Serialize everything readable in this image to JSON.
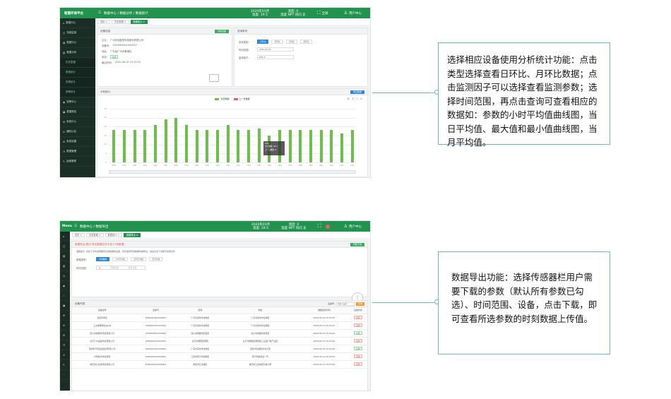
{
  "screenshot1": {
    "app_title": "智慧环保平台",
    "breadcrumb": "数据中心 / 数据分析 / 数据统计",
    "top_item_1": "2020年01月",
    "top_item_2": "温度: 19.5",
    "top_item_3": "湿度: 0",
    "top_item_4": "温度 NPT 风向 东",
    "top_item_5": "全屏",
    "top_user": "用户中心",
    "tabs": [
      "首页 ×",
      "历史数据 ×",
      "数据统计 ×"
    ],
    "sidebar": [
      "数据中心",
      "传感监测",
      "数据中心",
      "数据分析",
      "历史数据",
      "数据统计",
      "告警统计",
      "报警统计",
      "告警中心",
      "数据报告",
      "系统中心",
      "通知公告",
      "系统设置",
      "数据管理",
      "运维管理"
    ],
    "device_panel": {
      "title": "设备信息",
      "button": "切换设备",
      "fields": [
        {
          "label": "企业:",
          "value": "广州凯瑞智慧科技股份有限公司"
        },
        {
          "label": "设备号:",
          "value": "2020062601000007"
        },
        {
          "label": "地址:",
          "value": "广东省广州市黄浦区"
        },
        {
          "label": "状态:",
          "value": "在线"
        },
        {
          "label": "最后时间:",
          "value": "2020-06-19 19:12:00"
        }
      ]
    },
    "condition_panel": {
      "title": "查询条件",
      "type_label": "查询类型:",
      "type_options": [
        "日环比",
        "月环比",
        "日同比",
        "月同比"
      ],
      "time_label": "时间范围:",
      "time_value": "2020-06-19",
      "factor_label": "监测因子:",
      "factor_value": "PM2.5"
    },
    "chart_panel": {
      "title": "分析统计",
      "button": "导出数据",
      "legend": [
        "当日数据",
        "上一日数据"
      ],
      "tooltip_time": "13时",
      "tooltip_line1": "当日数据: 24.5",
      "tooltip_line2": "上一日数据: 0"
    },
    "chart_data": {
      "type": "bar",
      "categories": [
        "00时",
        "01时",
        "02时",
        "03时",
        "04时",
        "05时",
        "06时",
        "07时",
        "08时",
        "09时",
        "10时",
        "11时",
        "12时",
        "13时",
        "14时",
        "15时",
        "16时",
        "17时",
        "18时",
        "19时",
        "20时",
        "21时",
        "22时",
        "23时"
      ],
      "series": [
        {
          "name": "当日数据",
          "values": [
            18,
            18,
            18,
            18,
            21,
            24,
            25,
            21,
            18,
            18,
            18,
            21,
            18,
            18,
            19,
            15,
            18,
            18,
            18,
            18,
            18,
            18,
            16,
            18
          ]
        },
        {
          "name": "上一日数据",
          "values": [
            0,
            0,
            0,
            0,
            0,
            0,
            0,
            0,
            0,
            0,
            0,
            0,
            0,
            0,
            0,
            0,
            0,
            0,
            0,
            0,
            0,
            0,
            0,
            0
          ]
        }
      ],
      "y_ticks": [
        "0",
        "5",
        "10",
        "15",
        "20",
        "25",
        "30"
      ],
      "ylim": [
        0,
        30
      ],
      "colors": {
        "当日数据": "#6cc04a",
        "上一日数据": "#e8635a"
      }
    }
  },
  "screenshot2": {
    "app_title": "Menu",
    "breadcrumb": "数据中心 / 数据导出",
    "tabs": [
      "首页 ×",
      "历史数据 ×",
      "数据统计 ×",
      "数据导出 ×"
    ],
    "export_panel": {
      "title": "数据导出(提示:导出数据文件大至少?份数据)",
      "button": "开始下载",
      "hint": "温馨提示: 当在下方勾选需要导出的数据的设备，则表格所有的数据将被导出，最后点击下载即可获得文件",
      "type_label": "数据类型:",
      "type_options": [
        "时刻数据",
        "小时平均值",
        "日均平均值",
        "月平均值"
      ],
      "time_label": "时间范围:",
      "time_start": "开始日期",
      "time_end": "结束日期"
    },
    "device_list": {
      "title": "设备列表",
      "search_label": "设备号:",
      "search_placeholder": "请输入设备",
      "search_button": "查询",
      "columns": [
        "设备名称",
        "设备号",
        "区域",
        "地址",
        "数据最新时间",
        "设备状态"
      ],
      "rows": [
        {
          "name": "温度风测试",
          "code": "2020061801000007",
          "area": "广东省深圳市龙岗区",
          "addr": "广东省深圳市龙岗区",
          "time": "2020-06-19 15:03:01",
          "status": "离线"
        },
        {
          "name": "工业物联网企业AIR",
          "code": "2020061501000001",
          "area": "广东省深圳市龙岗区",
          "addr": "广东省深圳市龙岗区",
          "time": "2020-06-19 15:03:01",
          "status": "离线"
        },
        {
          "name": "四川省成都市测试有限公司",
          "code": "2020060501000004",
          "area": "四川省成都市武侯区",
          "addr": "四川省成都市武侯区",
          "time": "2020-06-19 15:20:20",
          "status": "在线"
        },
        {
          "name": "北京广州设备测试有限公司",
          "code": "2020061501000001",
          "area": "北京市朝阳区朝阳",
          "addr": "北京市朝阳区朝阳路工业园广电产业园",
          "time": "2020-06-19 15:20:20",
          "status": "离线"
        },
        {
          "name": "深圳市华百建设股份有限公司",
          "code": "2020061501000001",
          "area": "广东省深圳市龙岗区",
          "addr": "深圳市龙岗区中建大厦",
          "time": "2020-06-19 15:03:03",
          "status": "在线"
        },
        {
          "name": "华南技术测试有限",
          "code": "2020061501000001",
          "area": "江苏省南京市建邺区",
          "addr": "南京新城建设一号",
          "time": "2020-06-19 15:03:03",
          "status": "离线"
        },
        {
          "name": "重庆市九龙坡测试有限公司",
          "code": "2020061501000001",
          "area": "重庆市九龙坡区",
          "addr": "重庆市九龙坡区科技大厦",
          "time": "2020-06-19 15:03:03",
          "status": "离线"
        }
      ]
    }
  },
  "callouts": {
    "analysis": "选择相应设备使用分析统计功能：点击类型选择查看日环比、月环比数据；点击监测因子可以选择查看监测参数；选择时间范围，再点击查询可查看相应的数据如：参数的小时平均值曲线图，当日平均值、最大值和最小值曲线图，当月平均值。",
    "export": "数据导出功能：选择传感器栏用户需要下载的参数（默认所有参数已勾选）、时间范围、设备，点击下载，即可查看所选参数的时刻数据上传值。"
  }
}
